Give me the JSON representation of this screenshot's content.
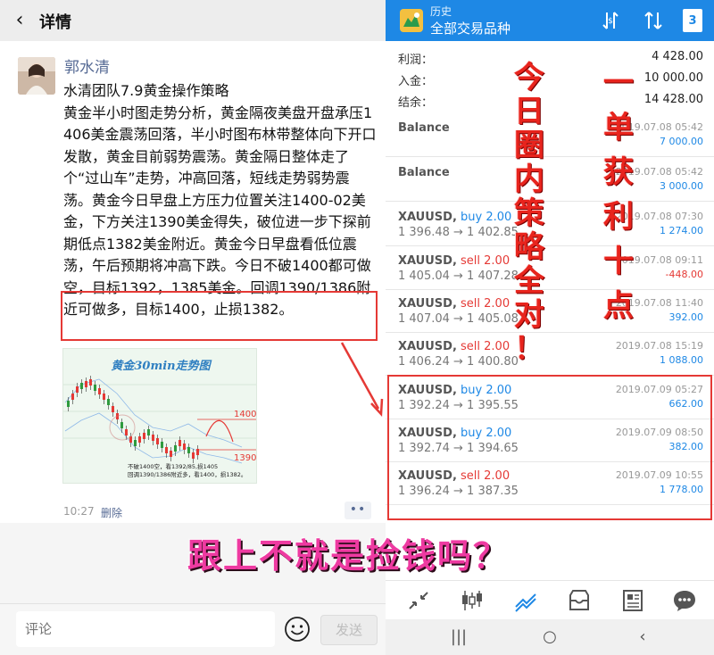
{
  "left": {
    "header": {
      "back_glyph": "‹",
      "title": "详情"
    },
    "post": {
      "author": "郭水清",
      "text": "水清团队7.9黄金操作策略\n黄金半小时图走势分析，黄金隔夜美盘开盘承压1406美金震荡回落，半小时图布林带整体向下开口发散，黄金目前弱势震荡。黄金隔日整体走了个“过山车”走势，冲高回落，短线走势弱势震荡。黄金今日早盘上方压力位置关注1400-02美金，下方关注1390美金得失，破位进一步下探前期低点1382美金附近。黄金今日早盘看低位震荡，午后预期将冲高下跌。今日不破1400都可做空，目标1392，1385美金。回调1390/1386附近可做多，目标1400，止损1382。",
      "time": "10:27",
      "delete_label": "删除",
      "more_glyph": "••",
      "chart": {
        "title": "黄金30min走势图",
        "label_high": "1400",
        "label_low": "1390",
        "note": "不破1400空，看1392/85,损1405\n回调1390/1386附近多，看1400，损1382。"
      }
    },
    "comment": {
      "placeholder": "评论",
      "send_label": "发送"
    }
  },
  "right": {
    "app_bar": {
      "subtitle": "历史",
      "title": "全部交易品种",
      "calendar_day": "3"
    },
    "summary": [
      {
        "label": "利润：",
        "value": "4 428.00"
      },
      {
        "label": "入金：",
        "value": "10 000.00"
      },
      {
        "label": "结余：",
        "value": "14 428.00"
      }
    ],
    "items": [
      {
        "title": "Balance",
        "dir": "",
        "prices": "",
        "date": "2019.07.08 05:42",
        "profit": "7 000.00",
        "neg": false
      },
      {
        "title": "Balance",
        "dir": "",
        "prices": "",
        "date": "2019.07.08 05:42",
        "profit": "3 000.00",
        "neg": false
      },
      {
        "title": "XAUUSD,",
        "dir": "buy 2.00",
        "prices": "1 396.48 → 1 402.85",
        "date": "2019.07.08 07:30",
        "profit": "1 274.00",
        "neg": false
      },
      {
        "title": "XAUUSD,",
        "dir": "sell 2.00",
        "prices": "1 405.04 → 1 407.28",
        "date": "2019.07.08 09:11",
        "profit": "-448.00",
        "neg": true
      },
      {
        "title": "XAUUSD,",
        "dir": "sell 2.00",
        "prices": "1 407.04 → 1 405.08",
        "date": "2019.07.08 11:40",
        "profit": "392.00",
        "neg": false
      },
      {
        "title": "XAUUSD,",
        "dir": "sell 2.00",
        "prices": "1 406.24 → 1 400.80",
        "date": "2019.07.08 15:19",
        "profit": "1 088.00",
        "neg": false
      },
      {
        "title": "XAUUSD,",
        "dir": "buy 2.00",
        "prices": "1 392.24 → 1 395.55",
        "date": "2019.07.09 05:27",
        "profit": "662.00",
        "neg": false
      },
      {
        "title": "XAUUSD,",
        "dir": "buy 2.00",
        "prices": "1 392.74 → 1 394.65",
        "date": "2019.07.09 08:50",
        "profit": "382.00",
        "neg": false
      },
      {
        "title": "XAUUSD,",
        "dir": "sell 2.00",
        "prices": "1 396.24 → 1 387.35",
        "date": "2019.07.09 10:55",
        "profit": "1 778.00",
        "neg": false
      }
    ],
    "slogan_left": [
      "今",
      "日",
      "圈",
      "内",
      "策",
      "略",
      "全",
      "对",
      "！"
    ],
    "slogan_right": [
      "一",
      "单",
      "获",
      "利",
      "十",
      "点"
    ],
    "bottom_tabs": [
      "trade-icon",
      "chart-icon",
      "history-icon",
      "inbox-icon",
      "news-icon",
      "chat-icon"
    ]
  },
  "overlay": "跟上不就是捡钱吗？",
  "colors": {
    "accent": "#1e88e5",
    "red": "#e53935",
    "link": "#576b95",
    "pink": "#ee3aa1"
  }
}
